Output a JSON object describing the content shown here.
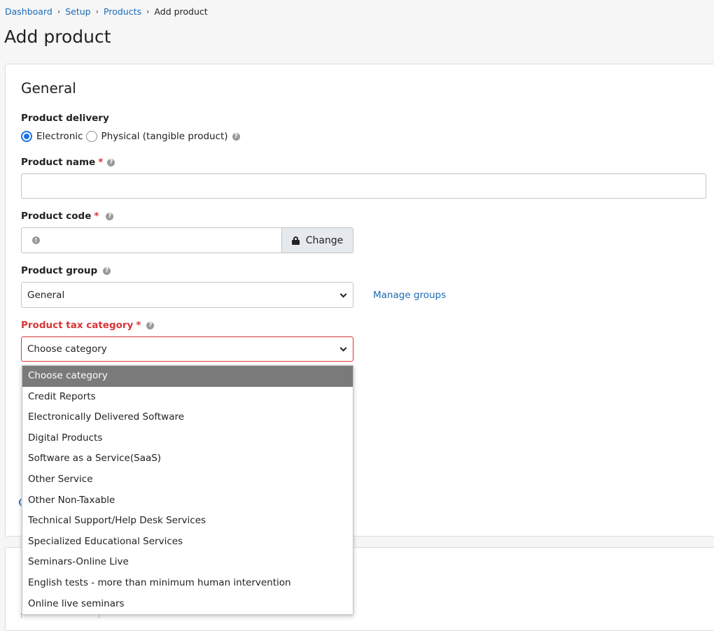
{
  "breadcrumb": {
    "items": [
      "Dashboard",
      "Setup",
      "Products"
    ],
    "current": "Add product",
    "separator": "›"
  },
  "page_title": "Add product",
  "general": {
    "section_title": "General",
    "delivery": {
      "label": "Product delivery",
      "options": [
        "Electronic",
        "Physical (tangible product)"
      ],
      "selected": "Electronic"
    },
    "name": {
      "label": "Product name",
      "required_mark": "*",
      "value": ""
    },
    "code": {
      "label": "Product code",
      "required_mark": "*",
      "value": "",
      "change_label": "Change"
    },
    "group": {
      "label": "Product group",
      "selected": "General",
      "manage_link": "Manage groups"
    },
    "tax_category": {
      "label": "Product tax category",
      "required_mark": "*",
      "selected": "Choose category",
      "options": [
        "Choose category",
        "Credit Reports",
        "Electronically Delivered Software",
        "Digital Products",
        "Software as a Service(SaaS)",
        "Other Service",
        "Other Non-Taxable",
        "Technical Support/Help Desk Services",
        "Specialized Educational Services",
        "Seminars-Online Live",
        "English tests - more than minimum human intervention",
        "Online live seminars"
      ]
    }
  },
  "colors": {
    "link": "#1a6bb5",
    "error": "#d63638",
    "radio_checked": "#1a73e8",
    "dropdown_highlight": "#7a7a7a"
  },
  "icons": {
    "help": "question-circle-icon",
    "info": "exclamation-circle-icon",
    "lock": "lock-icon",
    "chevron": "chevron-down-icon"
  }
}
